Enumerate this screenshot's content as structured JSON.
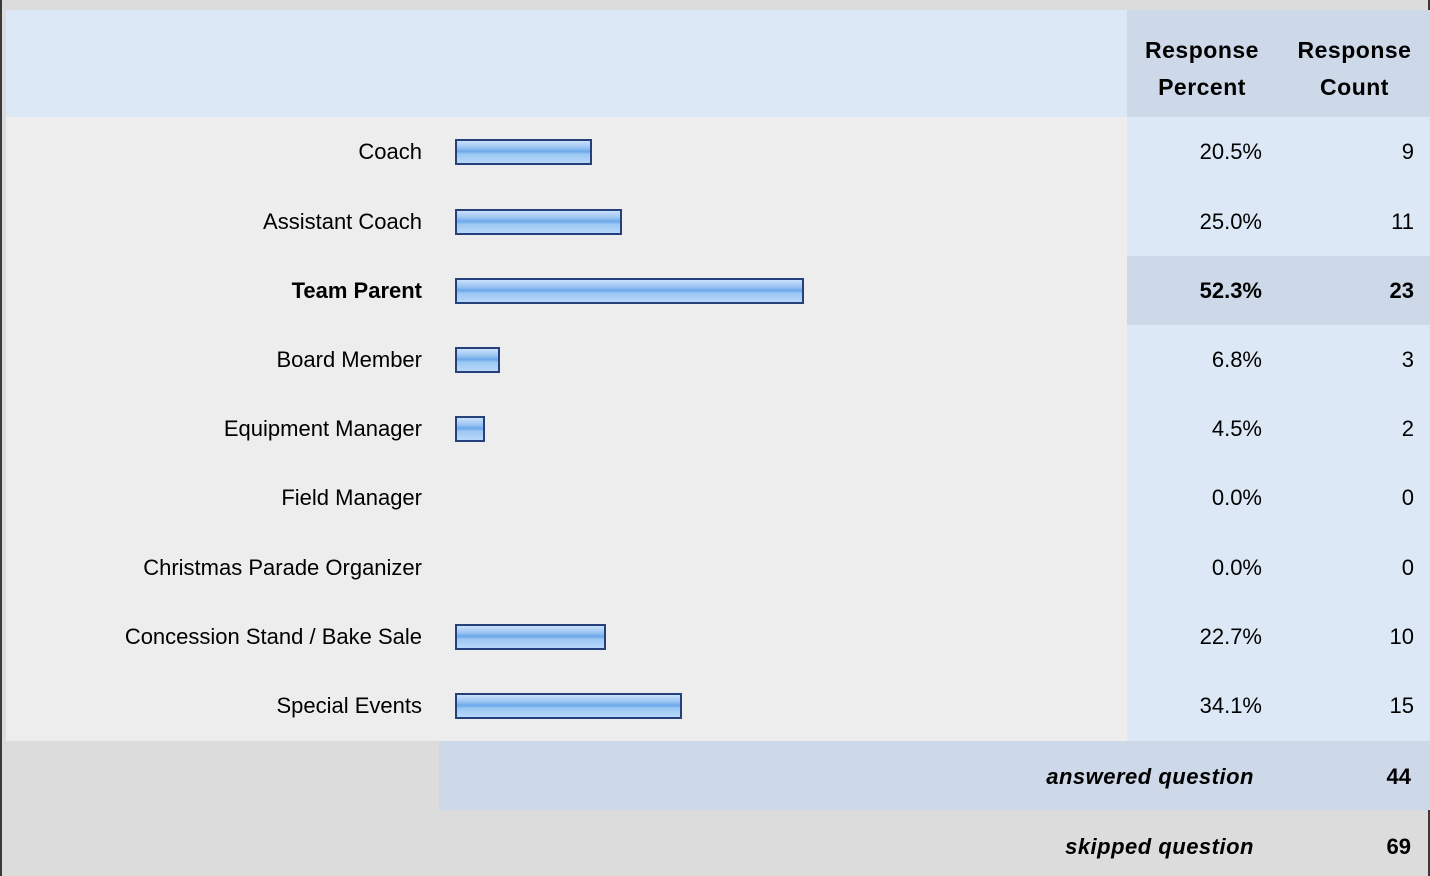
{
  "header": {
    "response_percent": [
      "Response",
      "Percent"
    ],
    "response_count": [
      "Response",
      "Count"
    ]
  },
  "chart_data": {
    "type": "bar",
    "orientation": "horizontal",
    "categories": [
      "Coach",
      "Assistant Coach",
      "Team Parent",
      "Board Member",
      "Equipment Manager",
      "Field Manager",
      "Christmas Parade Organizer",
      "Concession Stand / Bake Sale",
      "Special Events"
    ],
    "series": [
      {
        "values": [
          20.5,
          25.0,
          52.3,
          6.8,
          4.5,
          0.0,
          0.0,
          22.7,
          34.1
        ]
      }
    ],
    "percent_labels": [
      "20.5%",
      "25.0%",
      "52.3%",
      "6.8%",
      "4.5%",
      "0.0%",
      "0.0%",
      "22.7%",
      "34.1%"
    ],
    "counts": [
      "9",
      "11",
      "23",
      "3",
      "2",
      "0",
      "0",
      "10",
      "15"
    ],
    "highlighted_category": "Team Parent",
    "xlim": [
      0,
      100
    ],
    "bar_color": "#8fbdf0",
    "bar_border_color": "#25407a"
  },
  "summary": {
    "answered_label": "answered question",
    "answered_value": "44",
    "skipped_label": "skipped question",
    "skipped_value": "69"
  },
  "colors": {
    "header_bg": "#dde8f6",
    "column_bg": "#dce8f6",
    "highlight_bg": "#cdd9e8",
    "body_bg": "#ededed",
    "footer_bg": "#dcdcdc"
  }
}
